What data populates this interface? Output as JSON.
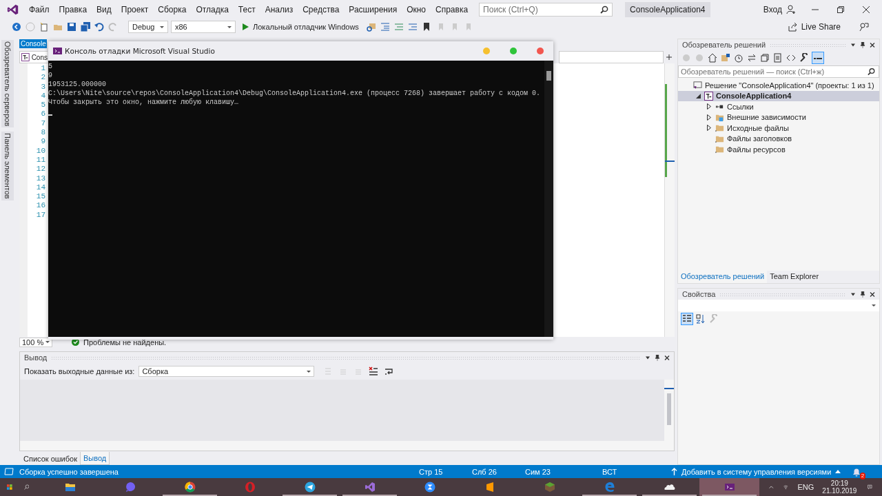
{
  "title_bar": {
    "menus": [
      "Файл",
      "Правка",
      "Вид",
      "Проект",
      "Сборка",
      "Отладка",
      "Тест",
      "Анализ",
      "Средства",
      "Расширения",
      "Окно",
      "Справка"
    ],
    "search": {
      "placeholder": "Поиск (Ctrl+Q)"
    },
    "solution_name": "ConsoleApplication4",
    "sign_in": "Вход"
  },
  "toolbar": {
    "configuration": "Debug",
    "platform": "x86",
    "debugger": "Локальный отладчик Windows",
    "live_share": "Live Share"
  },
  "side_tabs": [
    "Обозреватель серверов",
    "Панель элементов"
  ],
  "editor": {
    "tab": "Console",
    "nav": "Cons",
    "line_numbers": [
      "1",
      "2",
      "3",
      "4",
      "5",
      "6",
      "7",
      "8",
      "9",
      "10",
      "11",
      "12",
      "13",
      "14",
      "15",
      "16",
      "17"
    ],
    "zoom": "100 %",
    "issues": "Проблемы не найдены."
  },
  "console_window": {
    "title": "Консоль отладки Microsoft Visual Studio",
    "lines": [
      "5",
      "9",
      "1953125.000000",
      "C:\\Users\\Nite\\source\\repos\\ConsoleApplication4\\Debug\\ConsoleApplication4.exe (процесс 7268) завершает работу с кодом 0.",
      "Чтобы закрыть это окно, нажмите любую клавишу…"
    ]
  },
  "output_panel": {
    "title": "Вывод",
    "show_from_label": "Показать выходные данные из:",
    "source": "Сборка"
  },
  "bottom_tabs": [
    {
      "label": "Список ошибок",
      "selected": false
    },
    {
      "label": "Вывод",
      "selected": true
    }
  ],
  "solution_explorer": {
    "title": "Обозреватель решений",
    "search": {
      "placeholder": "Обозреватель решений — поиск (Ctrl+ж)"
    },
    "tree": [
      {
        "label": "Решение \"ConsoleApplication4\" (проекты: 1 из 1)",
        "kind": "solution",
        "expandable": false,
        "selected": false,
        "children": [
          {
            "label": "ConsoleApplication4",
            "kind": "project",
            "expandable": true,
            "expanded": true,
            "selected": true,
            "children": [
              {
                "label": "Ссылки",
                "kind": "references",
                "expandable": true,
                "expanded": false,
                "selected": false
              },
              {
                "label": "Внешние зависимости",
                "kind": "external",
                "expandable": true,
                "expanded": false,
                "selected": false
              },
              {
                "label": "Исходные файлы",
                "kind": "folder",
                "expandable": true,
                "expanded": false,
                "selected": false
              },
              {
                "label": "Файлы заголовков",
                "kind": "folder",
                "expandable": false,
                "selected": false
              },
              {
                "label": "Файлы ресурсов",
                "kind": "folder",
                "expandable": false,
                "selected": false
              }
            ]
          }
        ]
      }
    ],
    "tabs": [
      {
        "label": "Обозреватель решений",
        "selected": true
      },
      {
        "label": "Team Explorer",
        "selected": false
      }
    ]
  },
  "properties": {
    "title": "Свойства"
  },
  "status_bar": {
    "message": "Сборка успешно завершена",
    "line": "Стр 15",
    "column": "Слб 26",
    "char": "Сим 23",
    "mode": "ВСТ",
    "source_control": "Добавить в систему управления версиями",
    "notifications": "2"
  },
  "taskbar": {
    "apps": [
      {
        "kind": "explorer",
        "open": false,
        "active": false
      },
      {
        "kind": "viber",
        "open": false,
        "active": false
      },
      {
        "kind": "chrome",
        "open": true,
        "active": false
      },
      {
        "kind": "opera",
        "open": false,
        "active": false
      },
      {
        "kind": "telegram",
        "open": true,
        "active": false
      },
      {
        "kind": "vs",
        "open": true,
        "active": false
      },
      {
        "kind": "zoom",
        "open": false,
        "active": false
      },
      {
        "kind": "sublime",
        "open": false,
        "active": false
      },
      {
        "kind": "minecraft",
        "open": false,
        "active": false
      },
      {
        "kind": "edge",
        "open": true,
        "active": false
      },
      {
        "kind": "cloud",
        "open": true,
        "active": false
      },
      {
        "kind": "console",
        "open": true,
        "active": true
      }
    ],
    "language": "ENG",
    "time": "20:19",
    "date": "21.10.2019"
  }
}
